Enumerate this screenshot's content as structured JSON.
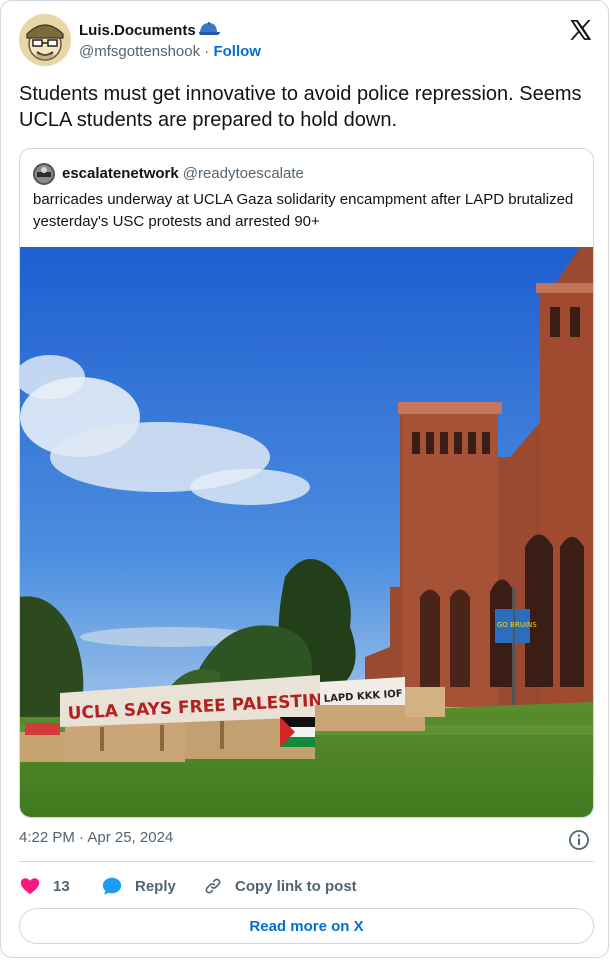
{
  "author": {
    "name": "Luis.Documents",
    "handle": "@mfsgottenshook",
    "separator": "·",
    "follow_label": "Follow",
    "badge_icon": "blue-cap-icon"
  },
  "tweet": {
    "text": "Students must get innovative to avoid police repression. Seems UCLA students are prepared to hold down."
  },
  "quote": {
    "name": "escalatenetwork",
    "handle": "@readytoescalate",
    "text": "barricades underway at UCLA Gaza solidarity encampment after LAPD brutalized yesterday's USC protests and arrested 90+",
    "photo": {
      "banner_text": "UCLA SAYS FREE PALESTINE",
      "banner2_text": "LAPD KKK IOF",
      "sign_text": "GO BRUINS"
    }
  },
  "meta": {
    "timestamp": "4:22 PM · Apr 25, 2024"
  },
  "actions": {
    "like_count": "13",
    "reply_label": "Reply",
    "copy_label": "Copy link to post"
  },
  "footer": {
    "read_more_label": "Read more on X"
  },
  "colors": {
    "accent": "#006fd6",
    "like": "#f91880",
    "reply": "#1d9bf0",
    "border": "#cfd9de",
    "muted": "#536471"
  }
}
